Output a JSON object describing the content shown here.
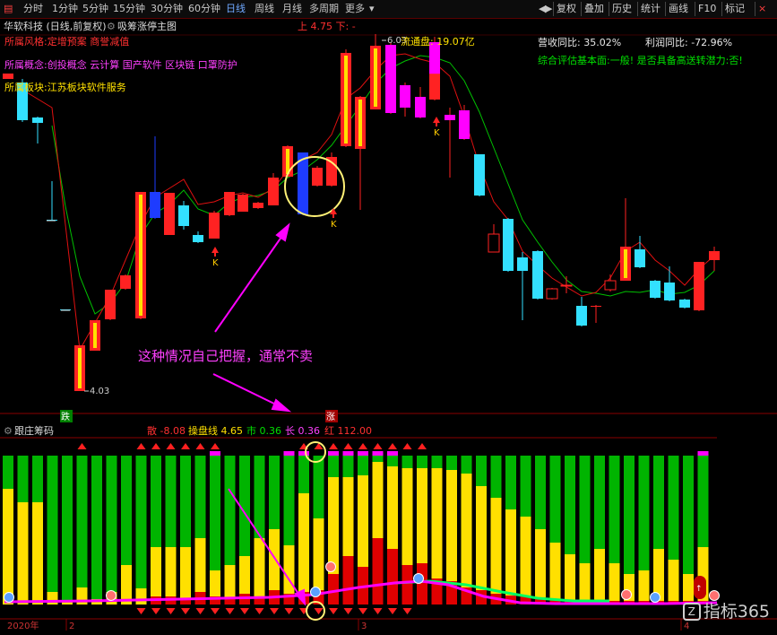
{
  "toolbar": {
    "left_icon": "menu-icon",
    "periods": [
      "分时",
      "1分钟",
      "5分钟",
      "15分钟",
      "30分钟",
      "60分钟",
      "日线",
      "周线",
      "月线",
      "多周期",
      "更多"
    ],
    "active_period": "日线",
    "right": [
      "复权",
      "叠加",
      "历史",
      "统计",
      "画线",
      "F10",
      "标记"
    ],
    "nav_icons": [
      "back-arrow-icon",
      "forward-arrow-icon"
    ]
  },
  "header": {
    "title": "华软科技 (日线,前复权)",
    "indicator": "吸筹涨停主图",
    "up_down": "上 4.75 下: -",
    "float_cap": "流通盘: 19.07亿",
    "top_price": "6.03",
    "low_price": "4.03"
  },
  "info": {
    "style": "所属风格:定增预案 商誉减值",
    "concept": "所属概念:创投概念 云计算 国产软件 区块链 口罩防护",
    "sector": "所属板块:江苏板块软件服务",
    "revenue": "营收同比:  35.02%",
    "profit": "利润同比:  -72.96%",
    "rating": "综合评估基本面:一般! 是否具备高送转潜力:否!"
  },
  "annotation": {
    "text": "这种情况自己把握，通常不卖",
    "label_die": "跌",
    "label_zhang": "涨",
    "k_label": "K"
  },
  "sub": {
    "title": "跟庄筹码",
    "v1": "散 -8.08",
    "v2": "操盘线 4.65",
    "v3": "市 0.36",
    "v4": "长 0.36",
    "v5": "红 112.00",
    "date": "2020年",
    "ticks": [
      "2",
      "3",
      "4"
    ],
    "watermark": "指标365",
    "watermark_icon": "logo-icon"
  },
  "colors": {
    "up": "#ff2222",
    "down": "#33e0ff",
    "accent": "#ff00ff",
    "yellow": "#ffe000",
    "green": "#00b400",
    "circle": "#fff176"
  }
}
